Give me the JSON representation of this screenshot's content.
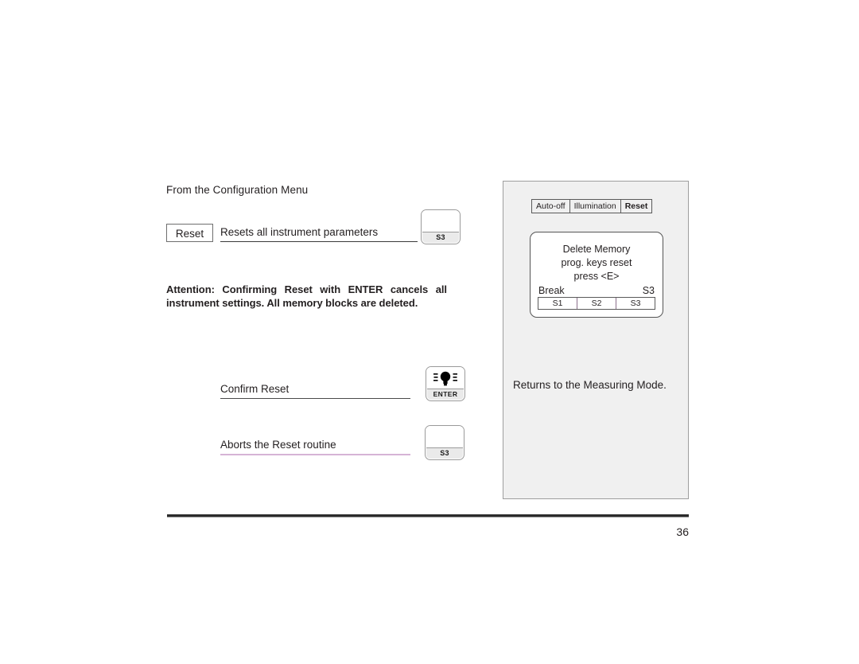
{
  "document": {
    "intro_line": "From the Configuration Menu",
    "page_number": "36"
  },
  "menu_row": {
    "chip_label": "Reset",
    "description": "Resets all instrument parameters",
    "key": {
      "legend": "S3",
      "face_icon": "blank"
    }
  },
  "attention": {
    "line1": "Attention: Confirming Reset with ENTER cancels all",
    "line2": "instrument settings. All memory blocks are deleted."
  },
  "confirm_row": {
    "label": "Confirm Reset",
    "key": {
      "legend": "ENTER",
      "face_icon": "light-bulb"
    }
  },
  "abort_row": {
    "label": "Aborts the Reset routine",
    "key": {
      "legend": "S3",
      "face_icon": "blank"
    }
  },
  "panel": {
    "tabs": [
      {
        "label": "Auto-off",
        "active": false
      },
      {
        "label": "Illumination",
        "active": false
      },
      {
        "label": "Reset",
        "active": true
      }
    ],
    "lcd": {
      "line1": "Delete Memory",
      "line2": "prog. keys reset",
      "line3": "press  <E>",
      "status_left": "Break",
      "status_right": "S3",
      "softkeys": [
        "S1",
        "S2",
        "S3"
      ]
    },
    "note": "Returns to the Measuring Mode."
  },
  "colors": {
    "panel_background": "#f0f0f0",
    "panel_border": "#9e9e9e",
    "text": "#231f20",
    "abort_underline": "#d6b4d6",
    "confirm_underline": "#4a4a4a",
    "key_legend_background": "#eaeaea",
    "footer_rule": "#2b2b2b"
  }
}
